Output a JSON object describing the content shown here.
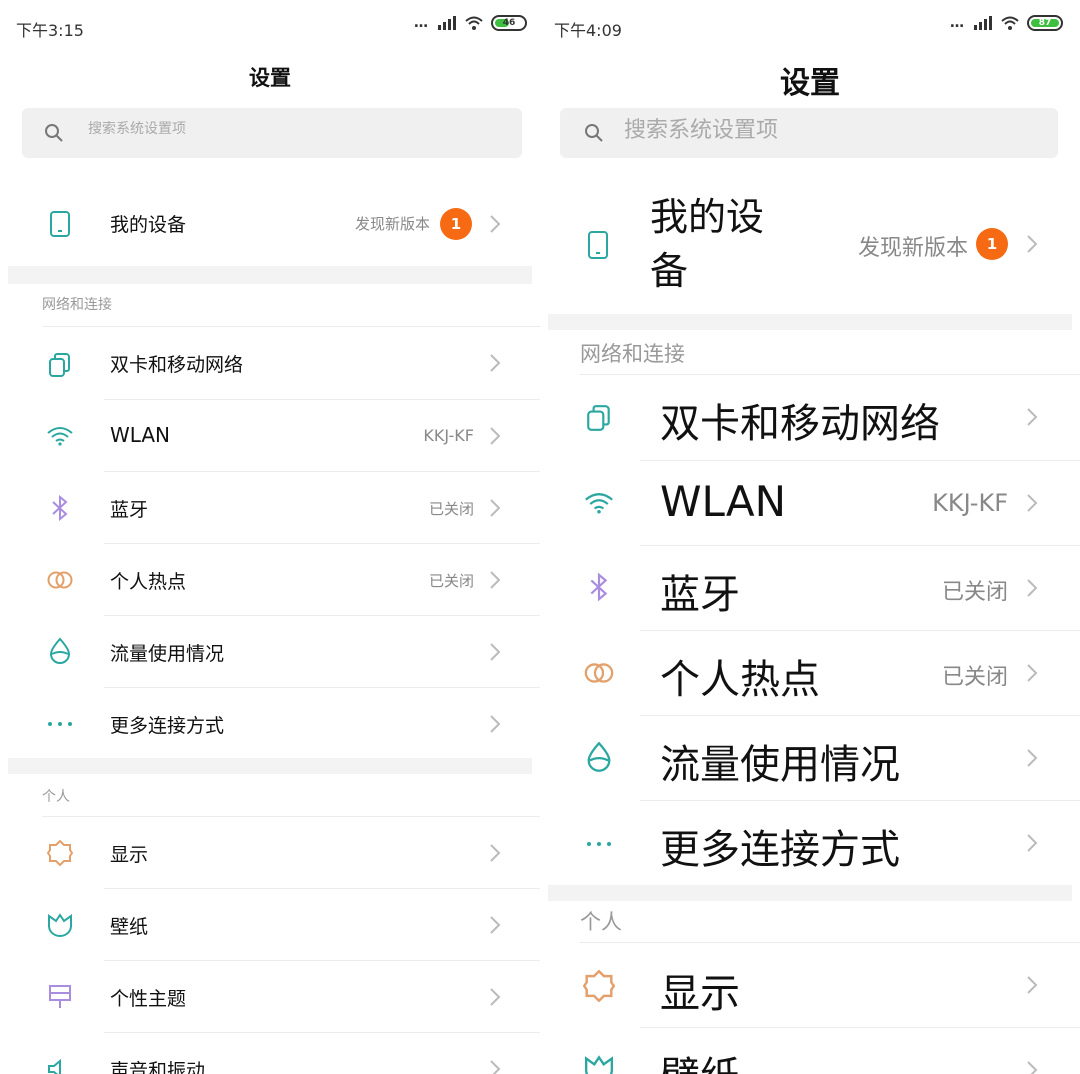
{
  "status": {
    "left_time": "下午3:15",
    "right_time": "下午4:09",
    "left_battery": "46",
    "right_battery": "87"
  },
  "header": {
    "title": "设置"
  },
  "search": {
    "placeholder": "搜索系统设置项"
  },
  "device": {
    "label": "我的设备",
    "update_text": "发现新版本",
    "badge_count": "1"
  },
  "sections": {
    "network": "网络和连接",
    "personal": "个人"
  },
  "network_items": [
    {
      "label": "双卡和移动网络",
      "value": ""
    },
    {
      "label": "WLAN",
      "value": "KKJ-KF"
    },
    {
      "label": "蓝牙",
      "value": "已关闭"
    },
    {
      "label": "个人热点",
      "value": "已关闭"
    },
    {
      "label": "流量使用情况",
      "value": ""
    },
    {
      "label": "更多连接方式",
      "value": ""
    }
  ],
  "personal_items": [
    {
      "label": "显示"
    },
    {
      "label": "壁纸"
    },
    {
      "label": "个性主题"
    },
    {
      "label": "声音和振动"
    }
  ],
  "icons": {
    "device": "phone-outline-icon",
    "sim": "dual-sim-icon",
    "wlan": "wifi-icon",
    "bluetooth": "bluetooth-icon",
    "hotspot": "hotspot-icon",
    "data": "data-usage-icon",
    "more": "more-dots-icon",
    "display": "display-brightness-icon",
    "wallpaper": "wallpaper-icon",
    "theme": "theme-icon",
    "sound": "sound-icon"
  },
  "colors": {
    "teal": "#2aa7a0",
    "purple": "#a98de0",
    "orange_icon": "#e3a06b",
    "badge": "#f56a13",
    "battery": "#3fbf3f"
  }
}
